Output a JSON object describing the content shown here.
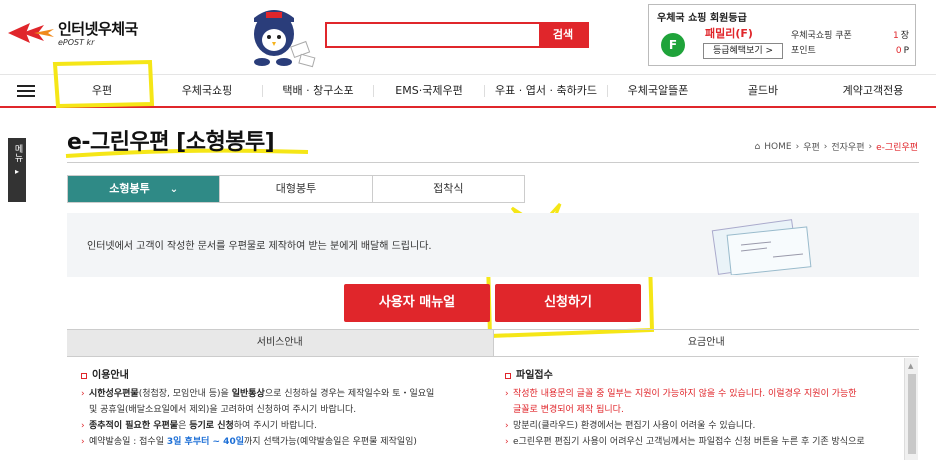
{
  "header": {
    "logo_title": "인터넷우체국",
    "logo_sub": "ePOST kr",
    "search": {
      "placeholder": "",
      "button_label": "검색"
    },
    "member": {
      "title": "우체국 쇼핑 회원등급",
      "grade_letter": "F",
      "grade_name": "패밀리(F)",
      "grade_button": "등급혜택보기 >",
      "stats": [
        {
          "label": "우체국쇼핑 쿠폰",
          "value": "1",
          "unit": "장"
        },
        {
          "label": "포인트",
          "value": "0",
          "unit": "P"
        }
      ]
    }
  },
  "nav": {
    "items": [
      {
        "label": "우편"
      },
      {
        "label": "우체국쇼핑"
      },
      {
        "label": "택배 · 창구소포"
      },
      {
        "label": "EMS·국제우편"
      },
      {
        "label": "우표 · 엽서 · 축하카드"
      },
      {
        "label": "우체국알뜰폰"
      },
      {
        "label": "골드바"
      },
      {
        "label": "계약고객전용"
      }
    ]
  },
  "side_tab": {
    "label": "메뉴"
  },
  "page": {
    "title": "e-그린우편 [소형봉투]",
    "breadcrumb": [
      "HOME",
      "우편",
      "전자우편",
      "e-그린우편"
    ]
  },
  "subtabs": [
    "소형봉투",
    "대형봉투",
    "접착식"
  ],
  "intro_text": "인터넷에서 고객이 작성한 문서를 우편물로 제작하여 받는 분에게 배달해 드립니다.",
  "buttons": {
    "manual": "사용자 매뉴얼",
    "apply": "신청하기"
  },
  "service_tabs": [
    "서비스안내",
    "요금안내"
  ],
  "usage": {
    "heading": "이용안내",
    "l1_b1": "시한성우편물",
    "l1_t1": "(청첩장, 모임안내 등)을 ",
    "l1_b2": "일반통상",
    "l1_t2": "으로 신청하실 경우는 제작일수와 토・일요일",
    "l1_cont": "및 공휴일(배달소요일에서 제외)을 고려하여 신청하여 주시기 바랍니다.",
    "l2_b1": "종추적이 필요한 우편물",
    "l2_t1": "은 ",
    "l2_b2": "등기로 신청",
    "l2_t2": "하여 주시기 바랍니다.",
    "l3_t1": "예약발송일 : 접수일 ",
    "l3_blue": "3일 후부터 ~ 40일",
    "l3_t2": "까지 선택가능(예약발송일은 우편물 제작일임)"
  },
  "file_receipt": {
    "heading": "파일접수",
    "l1": "작성한 내용문의 글꼴 중 일부는 지원이 가능하지 않을 수 있습니다. 이럴경우 지원이 가능한",
    "l1_cont": "글꼴로 변경되어 제작 됩니다.",
    "l2": "망분리(클라우드) 환경에서는 편집기 사용이 어려울 수 있습니다.",
    "l3": "e그린우편 편집기 사용이 어려우신 고객님께서는 파일접수 신청 버튼을 누른 후 기존 방식으로"
  },
  "colors": {
    "accent": "#e0262b",
    "teal": "#2f8a86",
    "highlight": "#f5e617",
    "grade": "#1fa33a"
  }
}
